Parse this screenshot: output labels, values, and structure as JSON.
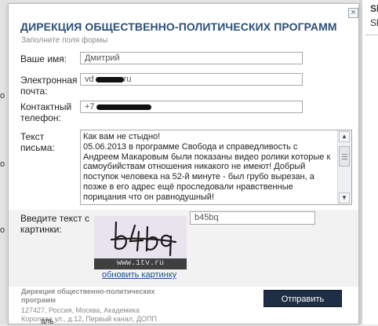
{
  "background": {
    "right_text_1": "Sl",
    "right_text_2": "Sl",
    "left_text_1": "o",
    "left_text_2": "o",
    "left_text_3": "o",
    "bottom_text": "аль"
  },
  "dialog": {
    "title": "ДИРЕКЦИЯ ОБЩЕСТВЕННО-ПОЛИТИЧЕСКИХ ПРОГРАММ",
    "subtitle": "Заполните поля формы",
    "close_symbol": "×"
  },
  "form": {
    "name_label": "Ваше имя:",
    "name_value": "Дмитрий",
    "email_label_1": "Электронная",
    "email_label_2": "почта:",
    "email_prefix": "vd",
    "email_suffix": "ru",
    "phone_label_1": "Контактный",
    "phone_label_2": "телефон:",
    "phone_prefix": "+7",
    "message_label_1": "Текст",
    "message_label_2": "письма:",
    "message_value": "Как вам не стыдно!\n05.06.2013 в программе Свобода и справедливость с Андреем Макаровым были показаны видео ролики которые к самоубийствам отношения никакого не имеют! Добрый поступок человека на 52-й минуте - был грубо вырезан, а позже в его адрес ещё проследовали нравственные порицания что он равнодушный!",
    "captcha_label_1": "Введите текст с",
    "captcha_label_2": "картинки:",
    "captcha_image_text": "b4bq",
    "captcha_watermark": "www.1tv.ru",
    "captcha_value": "b45bq",
    "refresh_link": "обновить картинку",
    "submit_label": "Отправить"
  },
  "footer": {
    "org_line_1": "Дирекция общественно-политических",
    "org_line_2": "программ",
    "address_line_1": "127427, Россия, Москва, Академика",
    "address_line_2": "Королева ул., д.12, Первый канал, ДОПП"
  },
  "colors": {
    "title": "#2c4f78",
    "submit_button": "#1e2f45",
    "link": "#1a4fa0"
  }
}
